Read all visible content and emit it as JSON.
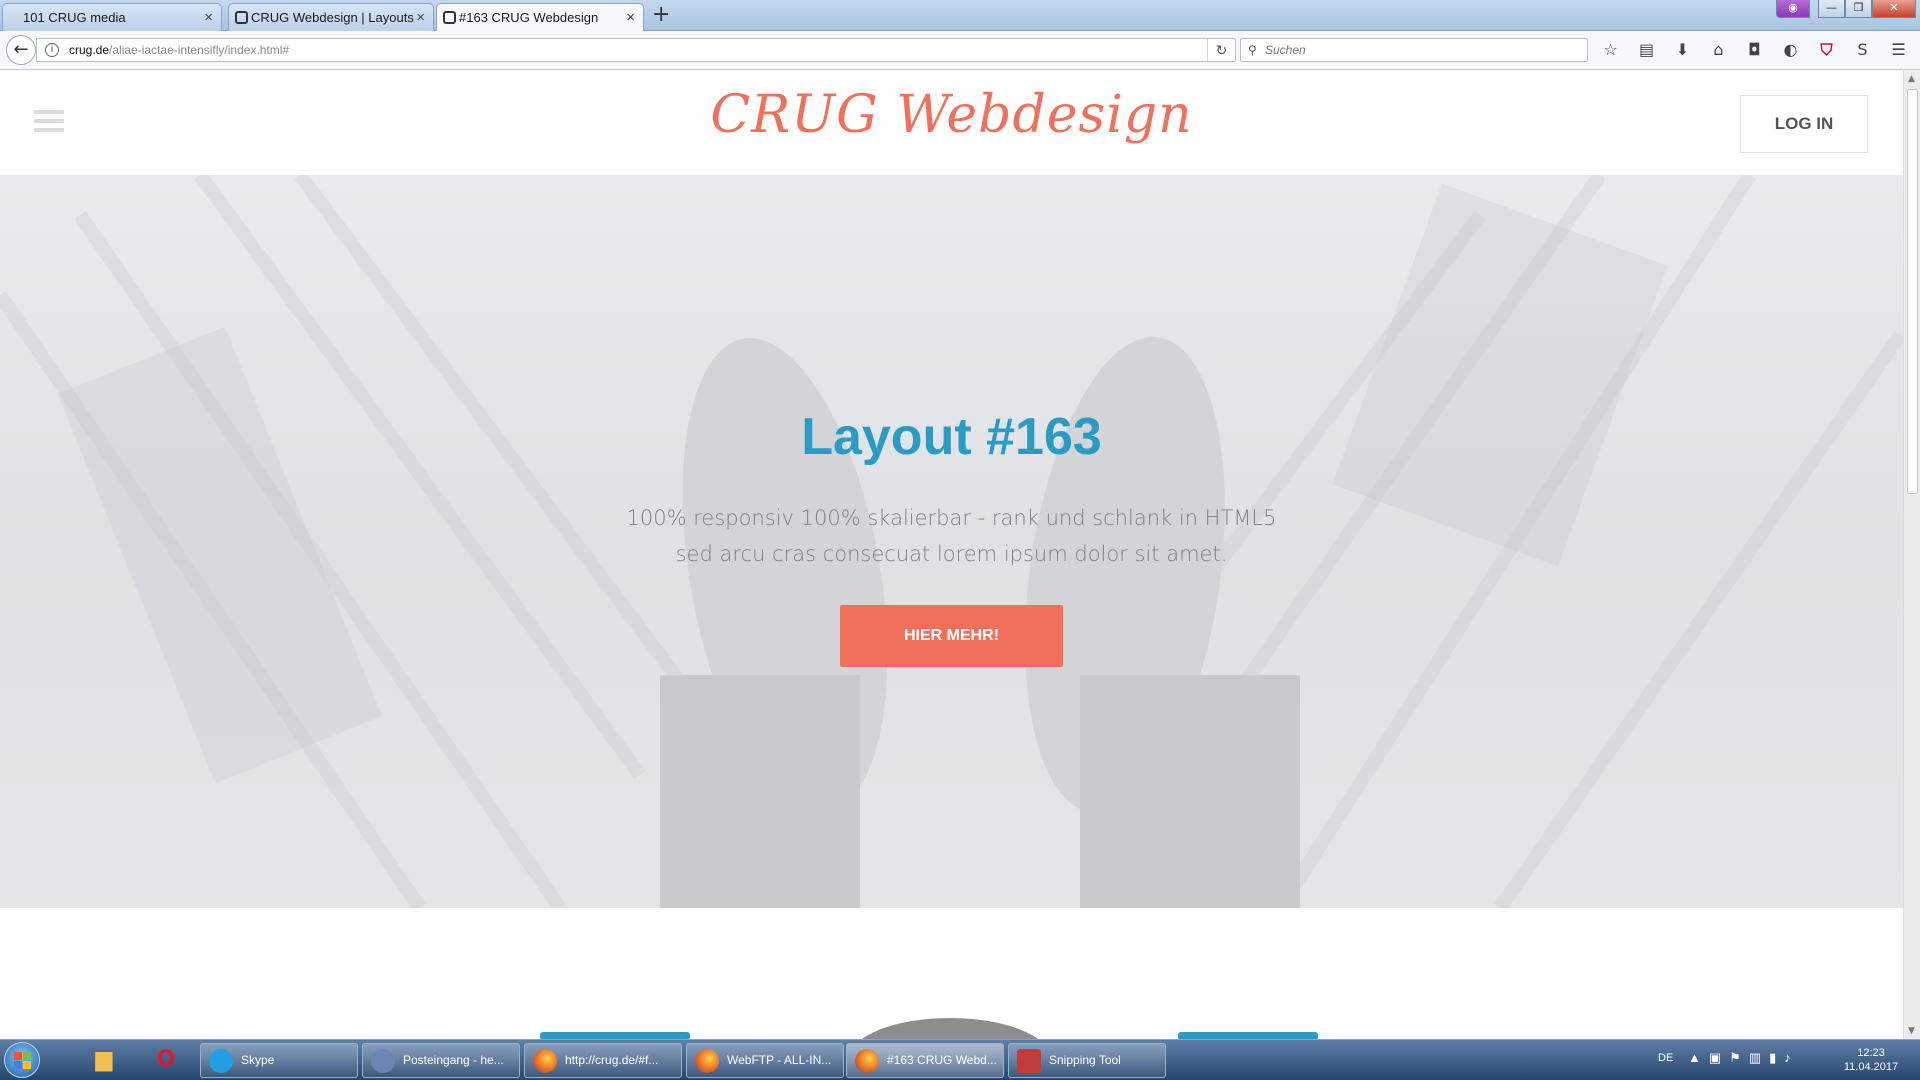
{
  "browser": {
    "tabs": [
      {
        "title": "101 CRUG media",
        "active": false
      },
      {
        "title": "CRUG Webdesign | Layouts",
        "active": false
      },
      {
        "title": "#163 CRUG Webdesign",
        "active": true
      }
    ],
    "tab_close": "×",
    "new_tab": "+",
    "window_buttons": {
      "mask": "◉",
      "minimize": "—",
      "maximize": "❐",
      "close": "✕"
    },
    "back": "←",
    "url_host": "crug.de",
    "url_path": "/aliae-iactae-intensifly/index.html#",
    "reload": "↻",
    "info": "i",
    "search_placeholder": "Suchen",
    "search_icon": "⚲",
    "toolbar_icons": [
      "☆",
      "▤",
      "⬇",
      "⌂",
      "◘",
      "◐",
      "⛉",
      "S",
      "☰"
    ]
  },
  "site": {
    "logo": "CRUG Webdesign",
    "login": "LOG IN",
    "hero_title": "Layout #163",
    "hero_sub_1": "100% responsiv 100% skalierbar - rank und schlank in HTML5",
    "hero_sub_2": "sed arcu cras consecuat lorem ipsum dolor sit amet.",
    "hero_button": "HIER MEHR!"
  },
  "scrollbar": {
    "up": "▲",
    "down": "▼"
  },
  "taskbar": {
    "pinned": [
      {
        "icon": "folder-icon",
        "glyph": "▆"
      },
      {
        "icon": "opera-icon",
        "glyph": "O"
      }
    ],
    "tasks": [
      {
        "label": "Skype",
        "icon": "skype"
      },
      {
        "label": "Posteingang - he...",
        "icon": "thunder"
      },
      {
        "label": "http://crug.de/#f...",
        "icon": "firefox"
      },
      {
        "label": "WebFTP - ALL-IN...",
        "icon": "firefox"
      },
      {
        "label": "#163 CRUG Webd...",
        "icon": "firefox"
      },
      {
        "label": "Snipping Tool",
        "icon": "snip"
      }
    ],
    "language": "DE",
    "tray_icons": [
      "▲",
      "▣",
      "⚑",
      "▥",
      "▮",
      "♪"
    ],
    "time": "12:23",
    "date": "11.04.2017"
  }
}
